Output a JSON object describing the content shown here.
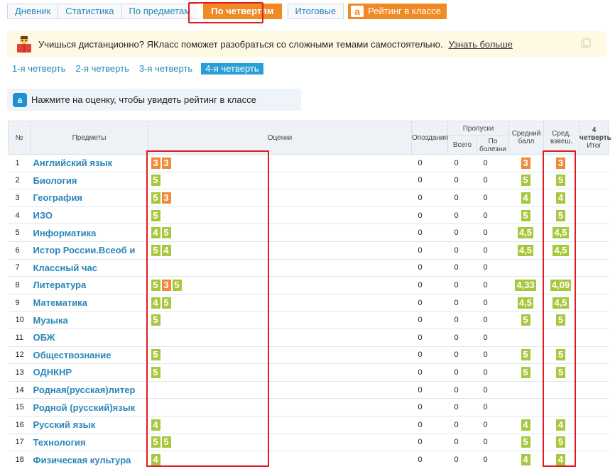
{
  "tabs": [
    {
      "label": "Дневник",
      "active": false
    },
    {
      "label": "Статистика",
      "active": false
    },
    {
      "label": "По предметам",
      "active": false
    },
    {
      "label": "По четвертям",
      "active": true
    },
    {
      "label": "Итоговые",
      "active": false
    }
  ],
  "rating_tab": {
    "logo": "a",
    "label": "Рейтинг в классе"
  },
  "banner": {
    "text": "Учишься дистанционно? ЯКласс поможет разобраться со сложными темами самостоятельно.",
    "link": "Узнать больше"
  },
  "quarters": [
    {
      "label": "1-я четверть",
      "active": false
    },
    {
      "label": "2-я четверть",
      "active": false
    },
    {
      "label": "3-я четверть",
      "active": false
    },
    {
      "label": "4-я четверть",
      "active": true
    }
  ],
  "hint": {
    "logo": "a",
    "text": "Нажмите на оценку, чтобы увидеть рейтинг в классе"
  },
  "table": {
    "headers": {
      "num": "№",
      "subject": "Предметы",
      "grades": "Оценки",
      "late": "Опоздания",
      "absences": "Пропуски",
      "absences_total": "Всего",
      "absences_sick_1": "По",
      "absences_sick_2": "болезни",
      "avg_1": "Средний",
      "avg_2": "балл",
      "weighted_1": "Сред.",
      "weighted_2": "взвеш.",
      "final_1": "4",
      "final_2": "четверть",
      "final_3": "Итог"
    },
    "rows": [
      {
        "n": "1",
        "subject": "Английский язык",
        "marks": [
          "3",
          "3"
        ],
        "late": "0",
        "total": "0",
        "sick": "0",
        "avg": "3",
        "weighted": "3"
      },
      {
        "n": "2",
        "subject": "Биология",
        "marks": [
          "5"
        ],
        "late": "0",
        "total": "0",
        "sick": "0",
        "avg": "5",
        "weighted": "5"
      },
      {
        "n": "3",
        "subject": "География",
        "marks": [
          "5",
          "3"
        ],
        "late": "0",
        "total": "0",
        "sick": "0",
        "avg": "4",
        "weighted": "4"
      },
      {
        "n": "4",
        "subject": "ИЗО",
        "marks": [
          "5"
        ],
        "late": "0",
        "total": "0",
        "sick": "0",
        "avg": "5",
        "weighted": "5"
      },
      {
        "n": "5",
        "subject": "Информатика",
        "marks": [
          "4",
          "5"
        ],
        "late": "0",
        "total": "0",
        "sick": "0",
        "avg": "4,5",
        "weighted": "4,5"
      },
      {
        "n": "6",
        "subject": "Истор России.Всеоб и",
        "marks": [
          "5",
          "4"
        ],
        "late": "0",
        "total": "0",
        "sick": "0",
        "avg": "4,5",
        "weighted": "4,5"
      },
      {
        "n": "7",
        "subject": "Классный час",
        "marks": [],
        "late": "0",
        "total": "0",
        "sick": "0",
        "avg": "",
        "weighted": ""
      },
      {
        "n": "8",
        "subject": "Литература",
        "marks": [
          "5",
          "3",
          "5"
        ],
        "late": "0",
        "total": "0",
        "sick": "0",
        "avg": "4,33",
        "weighted": "4,09"
      },
      {
        "n": "9",
        "subject": "Математика",
        "marks": [
          "4",
          "5"
        ],
        "late": "0",
        "total": "0",
        "sick": "0",
        "avg": "4,5",
        "weighted": "4,5"
      },
      {
        "n": "10",
        "subject": "Музыка",
        "marks": [
          "5"
        ],
        "late": "0",
        "total": "0",
        "sick": "0",
        "avg": "5",
        "weighted": "5"
      },
      {
        "n": "11",
        "subject": "ОБЖ",
        "marks": [],
        "late": "0",
        "total": "0",
        "sick": "0",
        "avg": "",
        "weighted": ""
      },
      {
        "n": "12",
        "subject": "Обществознание",
        "marks": [
          "5"
        ],
        "late": "0",
        "total": "0",
        "sick": "0",
        "avg": "5",
        "weighted": "5"
      },
      {
        "n": "13",
        "subject": "ОДНКНР",
        "marks": [
          "5"
        ],
        "late": "0",
        "total": "0",
        "sick": "0",
        "avg": "5",
        "weighted": "5"
      },
      {
        "n": "14",
        "subject": "Родная(русская)литер",
        "marks": [],
        "late": "0",
        "total": "0",
        "sick": "0",
        "avg": "",
        "weighted": ""
      },
      {
        "n": "15",
        "subject": "Родной (русский)язык",
        "marks": [],
        "late": "0",
        "total": "0",
        "sick": "0",
        "avg": "",
        "weighted": ""
      },
      {
        "n": "16",
        "subject": "Русский язык",
        "marks": [
          "4"
        ],
        "late": "0",
        "total": "0",
        "sick": "0",
        "avg": "4",
        "weighted": "4"
      },
      {
        "n": "17",
        "subject": "Технология",
        "marks": [
          "5",
          "5"
        ],
        "late": "0",
        "total": "0",
        "sick": "0",
        "avg": "5",
        "weighted": "5"
      },
      {
        "n": "18",
        "subject": "Физическая культура",
        "marks": [
          "4"
        ],
        "late": "0",
        "total": "0",
        "sick": "0",
        "avg": "4",
        "weighted": "4"
      }
    ]
  },
  "colors": {
    "mark_good": "#a7c83e",
    "mark_satisfactory": "#ef8a3a",
    "accent": "#f08a24",
    "link": "#2a86b8",
    "highlight": "#e21b23"
  },
  "icons": {
    "banner": "reading-student-icon",
    "banner_close": "copy-icon",
    "rating": "yaklass-logo-icon",
    "hint": "yaklass-logo-icon"
  }
}
